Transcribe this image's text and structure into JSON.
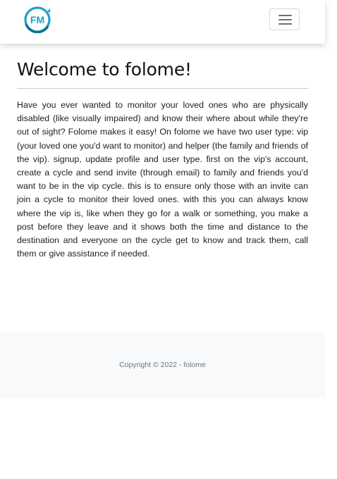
{
  "header": {
    "logo_text": "FM",
    "menu_icon": "hamburger-menu-icon"
  },
  "colors": {
    "brand": "#1ba1c9",
    "brand_dark": "#0f6f93",
    "footer_bg": "#f8f9fa"
  },
  "main": {
    "title": "Welcome to folome!",
    "description": "Have you ever wanted to monitor your loved ones who are physically disabled (like visually impaired) and know their where about while they're out of sight? Folome makes it easy! On folome we have two user type: vip (your loved one you'd want to monitor) and helper (the family and friends of the vip). signup, update profile and user type. first on the vip's account, create a cycle and send invite (through email) to family and friends you'd want to be in the vip cycle. this is to ensure only those with an invite can join a cycle to monitor their loved ones. with this you can always know where the vip is, like when they go for a walk or something, you make a post before they leave and it shows both the time and distance to the destination and everyone on the cycle get to know and track them, call them or give assistance if needed."
  },
  "footer": {
    "copyright": "Copyright © 2022 - folome"
  }
}
